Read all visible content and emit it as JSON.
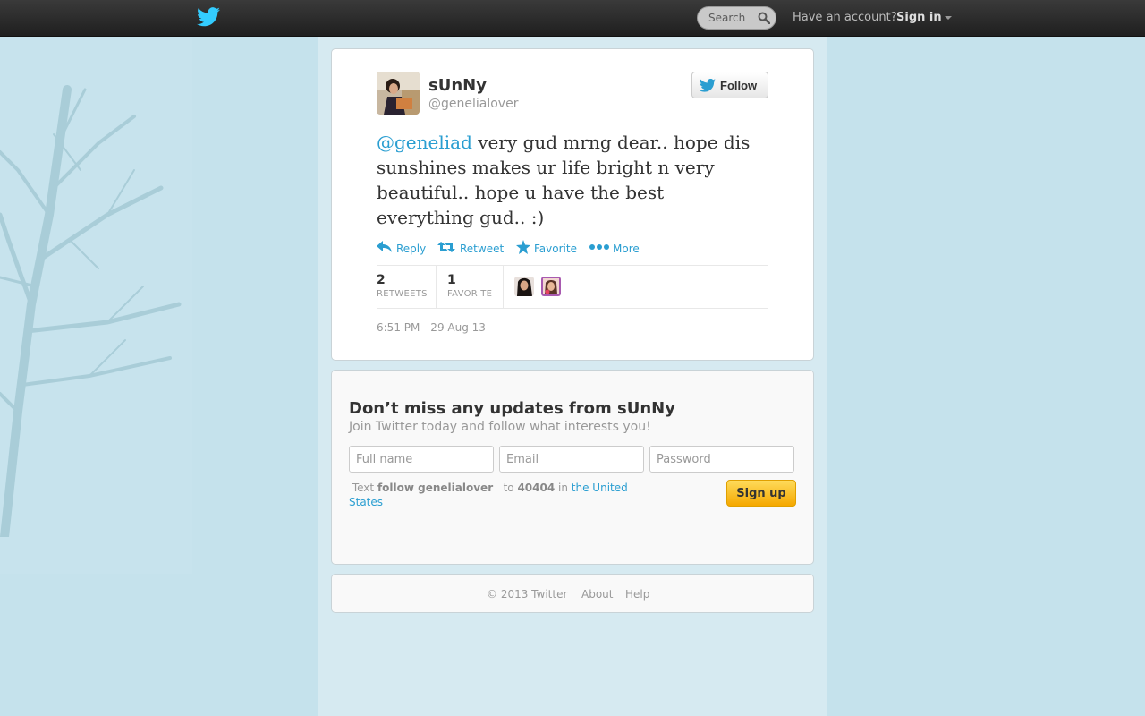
{
  "topbar": {
    "search_placeholder": "Search",
    "have_account": "Have an account?",
    "sign_in": "Sign in"
  },
  "tweet": {
    "full_name": "sUnNy",
    "screen_name": "@genelialover",
    "follow_label": "Follow",
    "mention": "@geneliad",
    "text": " very gud mrng dear.. hope dis sunshines makes ur life bright n very beautiful.. hope u have the best everything gud.. :)",
    "actions": {
      "reply": "Reply",
      "retweet": "Retweet",
      "favorite": "Favorite",
      "more": "More"
    },
    "stats": {
      "retweets_count": "2",
      "retweets_label": "RETWEETS",
      "favorites_count": "1",
      "favorites_label": "FAVORITE"
    },
    "timestamp": "6:51 PM - 29 Aug 13"
  },
  "signup": {
    "heading": "Don’t miss any updates from sUnNy",
    "subheading": "Join Twitter today and follow what interests you!",
    "fullname_placeholder": "Full name",
    "email_placeholder": "Email",
    "password_placeholder": "Password",
    "sms_text": "Text",
    "sms_command": "follow genelialover",
    "sms_to": "to",
    "sms_number": "40404",
    "sms_in": "in",
    "sms_country": "the United States",
    "signup_label": "Sign up"
  },
  "footer": {
    "copyright": "© 2013 Twitter",
    "about": "About",
    "help": "Help"
  },
  "colors": {
    "accent": "#2a9ed1",
    "page_bg": "#c5e2ec",
    "signup_button": "#f5a800"
  },
  "icons": [
    "twitter-bird-icon",
    "search-icon",
    "caret-down-icon",
    "reply-icon",
    "retweet-icon",
    "favorite-star-icon",
    "more-dots-icon"
  ]
}
